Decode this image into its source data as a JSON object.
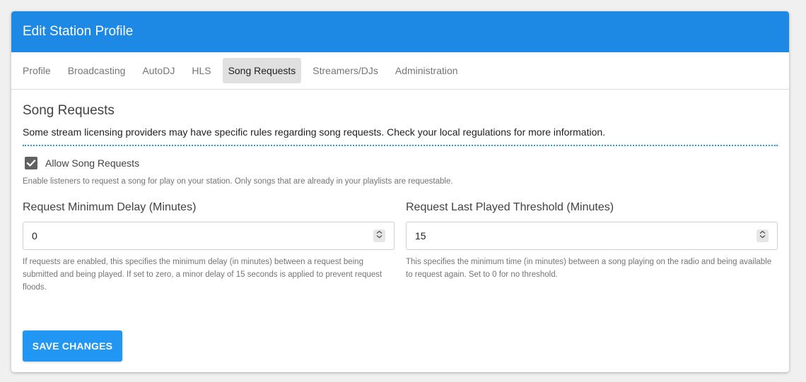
{
  "header": {
    "title": "Edit Station Profile"
  },
  "tabs": [
    {
      "label": "Profile",
      "active": false
    },
    {
      "label": "Broadcasting",
      "active": false
    },
    {
      "label": "AutoDJ",
      "active": false
    },
    {
      "label": "HLS",
      "active": false
    },
    {
      "label": "Song Requests",
      "active": true
    },
    {
      "label": "Streamers/DJs",
      "active": false
    },
    {
      "label": "Administration",
      "active": false
    }
  ],
  "section": {
    "title": "Song Requests",
    "description": "Some stream licensing providers may have specific rules regarding song requests. Check your local regulations for more information."
  },
  "allow_requests": {
    "label": "Allow Song Requests",
    "checked": true,
    "help": "Enable listeners to request a song for play on your station. Only songs that are already in your playlists are requestable."
  },
  "fields": {
    "min_delay": {
      "label": "Request Minimum Delay (Minutes)",
      "value": "0",
      "help": "If requests are enabled, this specifies the minimum delay (in minutes) between a request being submitted and being played. If set to zero, a minor delay of 15 seconds is applied to prevent request floods."
    },
    "threshold": {
      "label": "Request Last Played Threshold (Minutes)",
      "value": "15",
      "help": "This specifies the minimum time (in minutes) between a song playing on the radio and being available to request again. Set to 0 for no threshold."
    }
  },
  "actions": {
    "save_label": "SAVE CHANGES"
  },
  "colors": {
    "header_bg": "#1e88e5",
    "accent": "#2196f3",
    "checkbox": "#616161",
    "active_tab_bg": "#e0e0e0"
  },
  "icons": {
    "checkbox": "checkmark-icon",
    "spinner": "up-down-chevron-icon"
  }
}
